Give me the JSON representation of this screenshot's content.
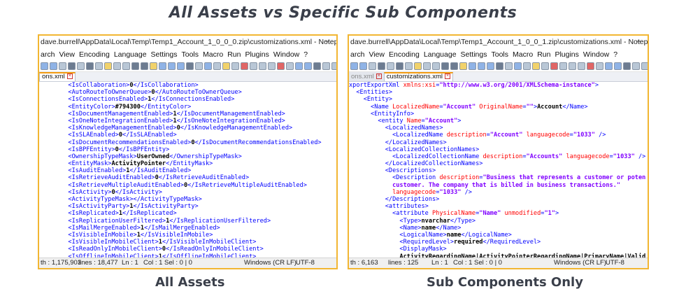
{
  "heading": "All Assets vs Specific Sub Components",
  "captions": {
    "left": "All Assets",
    "right": "Sub Components Only"
  },
  "left": {
    "title": "dave.burrell\\AppData\\Local\\Temp\\Temp1_Account_1_0_0_0.zip\\customizations.xml - Notepad++ [Admini...",
    "menu": [
      "arch",
      "View",
      "Encoding",
      "Language",
      "Settings",
      "Tools",
      "Macro",
      "Run",
      "Plugins",
      "Window",
      "?"
    ],
    "tabs": [
      {
        "label": "ons.xml",
        "active": true
      }
    ],
    "status": {
      "length": "th : 1,175,903",
      "lines": "lines : 18,477",
      "ln": "Ln : 1",
      "col": "Col : 1",
      "sel": "Sel : 0 | 0",
      "eol": "Windows (CR LF)",
      "enc": "UTF-8"
    },
    "lines": [
      [
        [
          "bl",
          "        <IsCollaboration>"
        ],
        [
          "tx",
          "0"
        ],
        [
          "bl",
          "</IsCollaboration>"
        ]
      ],
      [
        [
          "bl",
          "        <AutoRouteToOwnerQueue>"
        ],
        [
          "tx",
          "0"
        ],
        [
          "bl",
          "</AutoRouteToOwnerQueue>"
        ]
      ],
      [
        [
          "bl",
          "        <IsConnectionsEnabled>"
        ],
        [
          "tx",
          "1"
        ],
        [
          "bl",
          "</IsConnectionsEnabled>"
        ]
      ],
      [
        [
          "bl",
          "        <EntityColor>"
        ],
        [
          "tx",
          "#794300"
        ],
        [
          "bl",
          "</EntityColor>"
        ]
      ],
      [
        [
          "bl",
          "        <IsDocumentManagementEnabled>"
        ],
        [
          "tx",
          "1"
        ],
        [
          "bl",
          "</IsDocumentManagementEnabled>"
        ]
      ],
      [
        [
          "bl",
          "        <IsOneNoteIntegrationEnabled>"
        ],
        [
          "tx",
          "1"
        ],
        [
          "bl",
          "</IsOneNoteIntegrationEnabled>"
        ]
      ],
      [
        [
          "bl",
          "        <IsKnowledgeManagementEnabled>"
        ],
        [
          "tx",
          "0"
        ],
        [
          "bl",
          "</IsKnowledgeManagementEnabled>"
        ]
      ],
      [
        [
          "bl",
          "        <IsSLAEnabled>"
        ],
        [
          "tx",
          "0"
        ],
        [
          "bl",
          "</IsSLAEnabled>"
        ]
      ],
      [
        [
          "bl",
          "        <IsDocumentRecommendationsEnabled>"
        ],
        [
          "tx",
          "0"
        ],
        [
          "bl",
          "</IsDocumentRecommendationsEnabled>"
        ]
      ],
      [
        [
          "bl",
          "        <IsBPFEntity>"
        ],
        [
          "tx",
          "0"
        ],
        [
          "bl",
          "</IsBPFEntity>"
        ]
      ],
      [
        [
          "bl",
          "        <OwnershipTypeMask>"
        ],
        [
          "tx",
          "UserOwned"
        ],
        [
          "bl",
          "</OwnershipTypeMask>"
        ]
      ],
      [
        [
          "bl",
          "        <EntityMask>"
        ],
        [
          "tx",
          "ActivityPointer"
        ],
        [
          "bl",
          "</EntityMask>"
        ]
      ],
      [
        [
          "bl",
          "        <IsAuditEnabled>"
        ],
        [
          "tx",
          "1"
        ],
        [
          "bl",
          "</IsAuditEnabled>"
        ]
      ],
      [
        [
          "bl",
          "        <IsRetrieveAuditEnabled>"
        ],
        [
          "tx",
          "0"
        ],
        [
          "bl",
          "</IsRetrieveAuditEnabled>"
        ]
      ],
      [
        [
          "bl",
          "        <IsRetrieveMultipleAuditEnabled>"
        ],
        [
          "tx",
          "0"
        ],
        [
          "bl",
          "</IsRetrieveMultipleAuditEnabled>"
        ]
      ],
      [
        [
          "bl",
          "        <IsActivity>"
        ],
        [
          "tx",
          "0"
        ],
        [
          "bl",
          "</IsActivity>"
        ]
      ],
      [
        [
          "bl",
          "        <ActivityTypeMask>"
        ],
        [
          "bl",
          "</ActivityTypeMask>"
        ]
      ],
      [
        [
          "bl",
          "        <IsActivityParty>"
        ],
        [
          "tx",
          "1"
        ],
        [
          "bl",
          "</IsActivityParty>"
        ]
      ],
      [
        [
          "bl",
          "        <IsReplicated>"
        ],
        [
          "tx",
          "1"
        ],
        [
          "bl",
          "</IsReplicated>"
        ]
      ],
      [
        [
          "bl",
          "        <IsReplicationUserFiltered>"
        ],
        [
          "tx",
          "1"
        ],
        [
          "bl",
          "</IsReplicationUserFiltered>"
        ]
      ],
      [
        [
          "bl",
          "        <IsMailMergeEnabled>"
        ],
        [
          "tx",
          "1"
        ],
        [
          "bl",
          "</IsMailMergeEnabled>"
        ]
      ],
      [
        [
          "bl",
          "        <IsVisibleInMobile>"
        ],
        [
          "tx",
          "1"
        ],
        [
          "bl",
          "</IsVisibleInMobile>"
        ]
      ],
      [
        [
          "bl",
          "        <IsVisibleInMobileClient>"
        ],
        [
          "tx",
          "1"
        ],
        [
          "bl",
          "</IsVisibleInMobileClient>"
        ]
      ],
      [
        [
          "bl",
          "        <IsReadOnlyInMobileClient>"
        ],
        [
          "tx",
          "0"
        ],
        [
          "bl",
          "</IsReadOnlyInMobileClient>"
        ]
      ],
      [
        [
          "bl",
          "        <IsOfflineInMobileClient>"
        ],
        [
          "tx",
          "1"
        ],
        [
          "bl",
          "</IsOfflineInMobileClient>"
        ]
      ]
    ]
  },
  "right": {
    "title": "dave.burrell\\AppData\\Local\\Temp\\Temp1_Account_1_0_0_1.zip\\customizations.xml - Notepad++ [Admini...",
    "menu": [
      "arch",
      "View",
      "Encoding",
      "Language",
      "Settings",
      "Tools",
      "Macro",
      "Run",
      "Plugins",
      "Window",
      "?"
    ],
    "tabs": [
      {
        "label": "ons.xml",
        "active": false
      },
      {
        "label": "customizations.xml",
        "active": true
      }
    ],
    "status": {
      "length": "th : 6,163",
      "lines": "lines : 125",
      "ln": "Ln : 1",
      "col": "Col : 1",
      "sel": "Sel : 0 | 0",
      "eol": "Windows (CR LF)",
      "enc": "UTF-8"
    },
    "lines": [
      [
        [
          "bl",
          "xportExportXml "
        ],
        [
          "an",
          "xmlns:xsi"
        ],
        [
          "bl",
          "="
        ],
        [
          "av",
          "\"http://www.w3.org/2001/XMLSchema-instance\""
        ],
        [
          "bl",
          ">"
        ]
      ],
      [
        [
          "bl",
          "  <Entities>"
        ]
      ],
      [
        [
          "bl",
          "    <Entity>"
        ]
      ],
      [
        [
          "bl",
          "      <Name "
        ],
        [
          "an",
          "LocalizedName"
        ],
        [
          "bl",
          "="
        ],
        [
          "av",
          "\"Account\""
        ],
        [
          "an",
          " OriginalName"
        ],
        [
          "bl",
          "="
        ],
        [
          "av",
          "\"\""
        ],
        [
          "bl",
          ">"
        ],
        [
          "tx",
          "Account"
        ],
        [
          "bl",
          "</Name>"
        ]
      ],
      [
        [
          "bl",
          "      <EntityInfo>"
        ]
      ],
      [
        [
          "bl",
          "        <entity "
        ],
        [
          "an",
          "Name"
        ],
        [
          "bl",
          "="
        ],
        [
          "av",
          "\"Account\""
        ],
        [
          "bl",
          ">"
        ]
      ],
      [
        [
          "bl",
          "          <LocalizedNames>"
        ]
      ],
      [
        [
          "bl",
          "            <LocalizedName "
        ],
        [
          "an",
          "description"
        ],
        [
          "bl",
          "="
        ],
        [
          "av",
          "\"Account\""
        ],
        [
          "an",
          " languagecode"
        ],
        [
          "bl",
          "="
        ],
        [
          "av",
          "\"1033\""
        ],
        [
          "bl",
          " />"
        ]
      ],
      [
        [
          "bl",
          "          </LocalizedNames>"
        ]
      ],
      [
        [
          "bl",
          "          <LocalizedCollectionNames>"
        ]
      ],
      [
        [
          "bl",
          "            <LocalizedCollectionName "
        ],
        [
          "an",
          "description"
        ],
        [
          "bl",
          "="
        ],
        [
          "av",
          "\"Accounts\""
        ],
        [
          "an",
          " languagecode"
        ],
        [
          "bl",
          "="
        ],
        [
          "av",
          "\"1033\""
        ],
        [
          "bl",
          " />"
        ]
      ],
      [
        [
          "bl",
          "          </LocalizedCollectionNames>"
        ]
      ],
      [
        [
          "bl",
          "          <Descriptions>"
        ]
      ],
      [
        [
          "bl",
          "            <Description "
        ],
        [
          "an",
          "description"
        ],
        [
          "bl",
          "="
        ],
        [
          "av",
          "\"Business that represents a customer or poten"
        ]
      ],
      [
        [
          "av",
          "            customer. The company that is billed in business transactions.\""
        ]
      ],
      [
        [
          "an",
          "            languagecode"
        ],
        [
          "bl",
          "="
        ],
        [
          "av",
          "\"1033\""
        ],
        [
          "bl",
          " />"
        ]
      ],
      [
        [
          "bl",
          "          </Descriptions>"
        ]
      ],
      [
        [
          "bl",
          "          <attributes>"
        ]
      ],
      [
        [
          "bl",
          "            <attribute "
        ],
        [
          "an",
          "PhysicalName"
        ],
        [
          "bl",
          "="
        ],
        [
          "av",
          "\"Name\""
        ],
        [
          "an",
          " unmodified"
        ],
        [
          "bl",
          "="
        ],
        [
          "av",
          "\"1\""
        ],
        [
          "bl",
          ">"
        ]
      ],
      [
        [
          "bl",
          "              <Type>"
        ],
        [
          "tx",
          "nvarchar"
        ],
        [
          "bl",
          "</Type>"
        ]
      ],
      [
        [
          "bl",
          "              <Name>"
        ],
        [
          "tx",
          "name"
        ],
        [
          "bl",
          "</Name>"
        ]
      ],
      [
        [
          "bl",
          "              <LogicalName>"
        ],
        [
          "tx",
          "name"
        ],
        [
          "bl",
          "</LogicalName>"
        ]
      ],
      [
        [
          "bl",
          "              <RequiredLevel>"
        ],
        [
          "tx",
          "required"
        ],
        [
          "bl",
          "</RequiredLevel>"
        ]
      ],
      [
        [
          "bl",
          "              <DisplayMask>"
        ]
      ],
      [
        [
          "tx",
          "              ActivityRegardingName|ActivityPointerRegardingName|PrimaryName|Valid"
        ]
      ]
    ]
  },
  "colors": {
    "frame": "#f2b632",
    "tag": "#0000ff",
    "attr_name": "#ff0000",
    "attr_value": "#8000ff",
    "text": "#000000"
  }
}
